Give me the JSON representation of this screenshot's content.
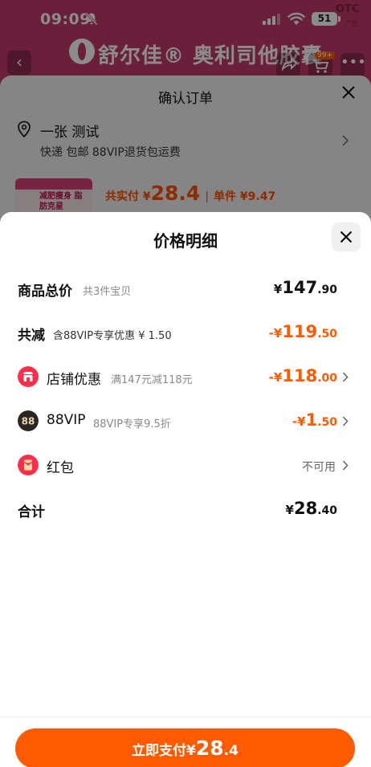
{
  "status_bar": {
    "time": "09:09",
    "battery": "51",
    "otc_badge": "OTC",
    "ad_tag": "广告"
  },
  "product_page": {
    "brand_name": "舒尔佳® 奥利司他胶囊",
    "cart_count": "99+"
  },
  "order_sheet": {
    "title": "确认订单",
    "recipient": "一张 测试",
    "shipping": "快递 包邮 88VIP退货包运费",
    "thumb_text": "减肥瘦身 脂肪克星",
    "total_label": "共实付 ¥",
    "total_amount": "28.4",
    "separator": "|",
    "unit_price": "单件 ¥9.47"
  },
  "price_detail": {
    "title": "价格明细",
    "rows": [
      {
        "label": "商品总价",
        "sub": "共3件宝贝",
        "yen": "¥",
        "int": "147",
        "dec": ".90"
      },
      {
        "label": "共减",
        "sub": "含88VIP专享优惠 ¥ 1.50",
        "yen": "-¥",
        "int": "119",
        "dec": ".50"
      },
      {
        "label": "店铺优惠",
        "sub": "满147元减118元",
        "yen": "-¥",
        "int": "118",
        "dec": ".00",
        "icon": "shop-coupon-icon"
      },
      {
        "label": "88VIP",
        "sub": "88VIP专享9.5折",
        "yen": "-¥",
        "int": "1",
        "dec": ".50",
        "icon": "vip-88-icon"
      },
      {
        "label": "红包",
        "status": "不可用",
        "icon": "red-packet-icon"
      },
      {
        "label": "合计",
        "yen": "¥",
        "int": "28",
        "dec": ".40"
      }
    ]
  },
  "pay_button": {
    "label": "立即支付",
    "yen": "¥",
    "int": "28",
    "dec": ".4"
  },
  "colors": {
    "accent": "#ff5a00",
    "brand": "#c23a6a"
  }
}
